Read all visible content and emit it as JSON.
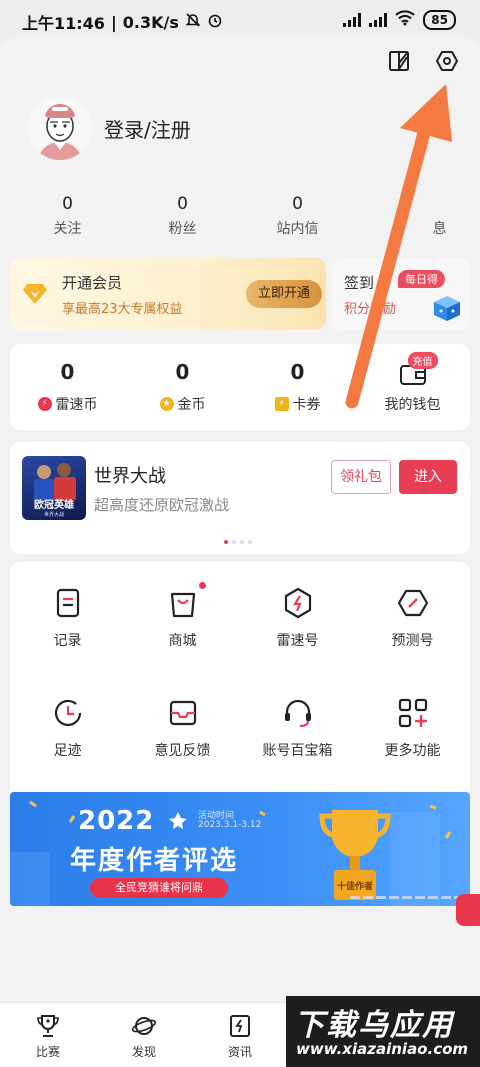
{
  "status": {
    "time": "上午11:46",
    "speed": "0.3K/s",
    "battery": "85"
  },
  "top_icons": [
    "layout-icon",
    "settings-icon"
  ],
  "profile": {
    "login_label": "登录/注册"
  },
  "stats": [
    {
      "num": "0",
      "label": "关注"
    },
    {
      "num": "0",
      "label": "粉丝"
    },
    {
      "num": "0",
      "label": "站内信"
    },
    {
      "num": "",
      "label": "息"
    }
  ],
  "vip": {
    "title": "开通会员",
    "subtitle": "享最高23大专属权益",
    "button": "立即开通"
  },
  "checkin": {
    "title": "签到",
    "tag": "每日得",
    "subtitle": "积分奖励"
  },
  "wallet": [
    {
      "num": "0",
      "label": "雷速币",
      "color": "#e8364c"
    },
    {
      "num": "0",
      "label": "金币",
      "color": "#f1b51c"
    },
    {
      "num": "0",
      "label": "卡券",
      "color": "#f1b51c"
    },
    {
      "num": "",
      "label": "我的钱包",
      "tag": "充值"
    }
  ],
  "game": {
    "title": "世界大战",
    "subtitle": "超高度还原欧冠激战",
    "thumb_text": "欧冠英雄",
    "thumb_sub": "世界大战",
    "gift_button": "领礼包",
    "enter_button": "进入"
  },
  "grid": [
    {
      "label": "记录",
      "icon": "record-icon"
    },
    {
      "label": "商城",
      "icon": "shop-icon"
    },
    {
      "label": "雷速号",
      "icon": "leisu-icon"
    },
    {
      "label": "预测号",
      "icon": "predict-icon"
    },
    {
      "label": "足迹",
      "icon": "history-icon"
    },
    {
      "label": "意见反馈",
      "icon": "feedback-icon"
    },
    {
      "label": "账号百宝箱",
      "icon": "support-icon"
    },
    {
      "label": "更多功能",
      "icon": "more-icon"
    }
  ],
  "banner": {
    "year": "2022",
    "time_label": "活动时间",
    "time_range": "2023.3.1-3.12",
    "title": "年度作者评选",
    "pill": "全民竞猜谁将问鼎",
    "trophy_text": "十佳作者"
  },
  "tabs": [
    {
      "label": "比赛",
      "icon": "trophy-icon"
    },
    {
      "label": "发现",
      "icon": "planet-icon"
    },
    {
      "label": "资讯",
      "icon": "news-icon"
    }
  ],
  "watermark": {
    "title": "下载乌应用",
    "url": "www.xiazainiao.com"
  },
  "colors": {
    "accent": "#e83e55",
    "annotation_arrow": "#f47a42",
    "banner": "#3a8ef5"
  }
}
